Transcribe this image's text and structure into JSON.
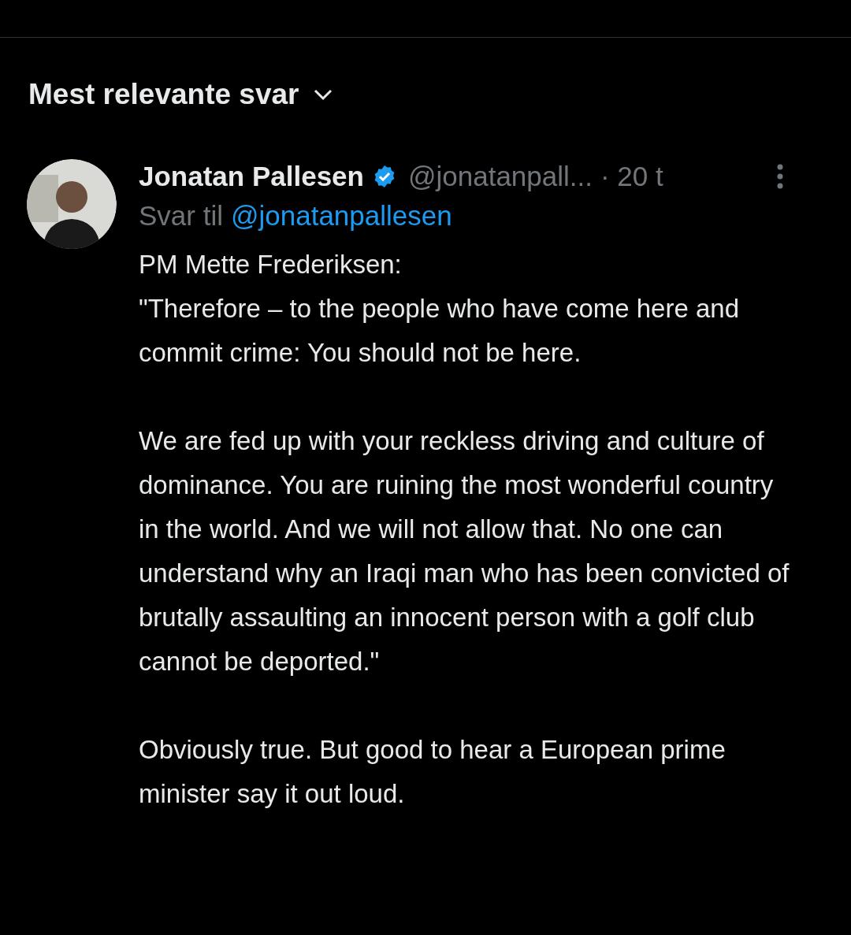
{
  "sort": {
    "label": "Mest relevante svar"
  },
  "reply": {
    "name": "Jonatan Pallesen",
    "verified": true,
    "handle": "@jonatanpall...",
    "time": "· 20 t",
    "reply_to_label": "Svar til",
    "reply_to_handle": "@jonatanpallesen",
    "paragraphs": [
      "PM Mette Frederiksen:\n\"Therefore – to the people who have come here and commit crime: You should not be here.",
      "We are fed up with your reckless driving and culture of dominance. You are ruining the most wonderful country in the world. And we will not allow that. No one can understand why an Iraqi man who has been convicted of brutally assaulting an innocent person with a golf club cannot be deported.\"",
      "Obviously true. But good to hear a European prime minister say it out loud."
    ]
  }
}
